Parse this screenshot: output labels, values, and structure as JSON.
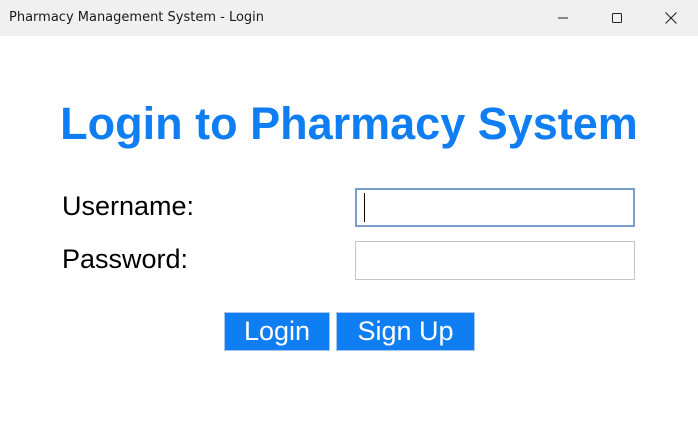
{
  "window": {
    "title": "Pharmacy Management System - Login",
    "controls": {
      "minimize_icon": "minimize-icon",
      "maximize_icon": "maximize-icon",
      "close_icon": "close-icon"
    }
  },
  "form": {
    "heading": "Login to Pharmacy System",
    "heading_color": "#0f7ef2",
    "username_label": "Username:",
    "username_value": "",
    "password_label": "Password:",
    "password_value": "",
    "login_label": "Login",
    "signup_label": "Sign Up",
    "button_color": "#0f7ef2"
  }
}
